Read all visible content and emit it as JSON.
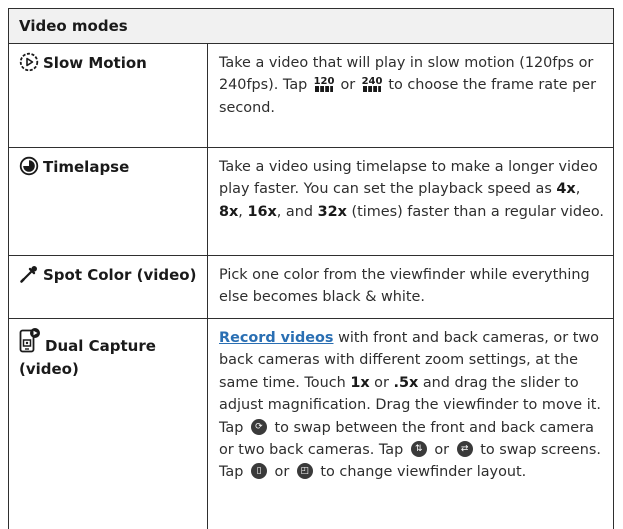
{
  "header": "Video modes",
  "rows": [
    {
      "name": "Slow Motion",
      "desc": {
        "t1": "Take a video that will play in slow motion (120fps or 240fps). Tap ",
        "t2": " or ",
        "t3": " to choose the frame rate per second."
      }
    },
    {
      "name": "Timelapse",
      "desc": {
        "t1": "Take a video using timelapse to make a longer video play faster. You can set the playback speed as ",
        "b1": "4x",
        "s1": ", ",
        "b2": "8x",
        "s2": ", ",
        "b3": "16x",
        "s3": ", and ",
        "b4": "32x",
        "t2": " (times) faster than a regular video."
      }
    },
    {
      "name": "Spot Color (video)",
      "desc": {
        "t1": "Pick one color from the viewfinder while everything else becomes black & white."
      }
    },
    {
      "name": "Dual Capture (video)",
      "desc": {
        "link": "Record videos",
        "t1": " with front and back cameras, or two back cameras with different zoom settings, at the same time. Touch ",
        "b1": "1x",
        "s1": " or ",
        "b2": ".5x",
        "t2": " and drag the slider to adjust magnification. Drag the viewfinder to move it. Tap ",
        "t3": " to swap between the front and back camera or two back cameras. Tap ",
        "t4": " or ",
        "t5": " to swap screens. Tap ",
        "t6": " or ",
        "t7": " to change viewfinder layout."
      }
    }
  ],
  "icons": {
    "slow_motion": "play-circle-icon",
    "timelapse": "timelapse-icon",
    "spot_color": "eyedropper-icon",
    "dual_capture": "dual-capture-icon",
    "fps120": "120",
    "fps240": "240"
  },
  "colors": {
    "link": "#2a6fb3",
    "border": "#2f2f2f",
    "header_bg": "#f1f1f1"
  }
}
